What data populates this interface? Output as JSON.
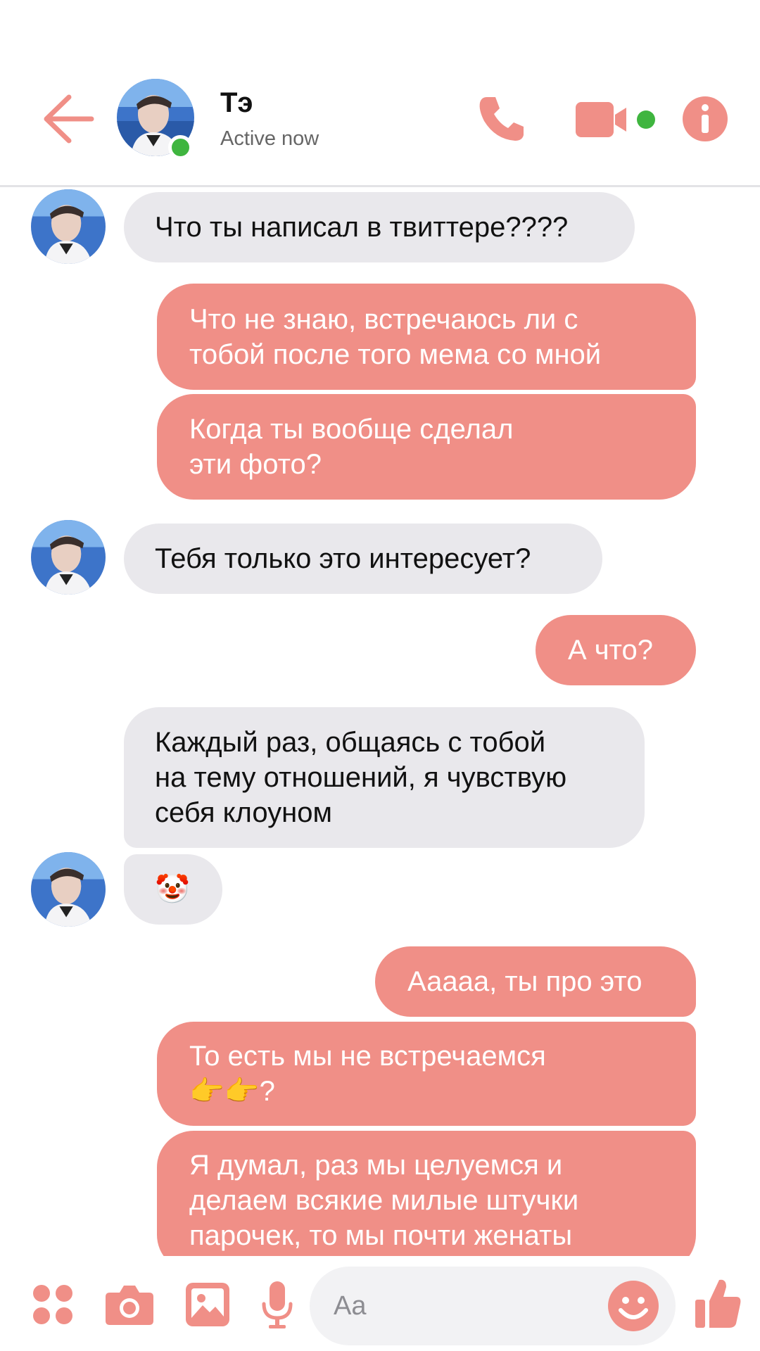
{
  "header": {
    "contact_name": "Тэ",
    "status": "Active now",
    "back_icon": "arrow-left-icon",
    "call_icon": "phone-icon",
    "video_icon": "video-camera-icon",
    "info_icon": "info-icon"
  },
  "colors": {
    "accent": "#f08f87",
    "incoming_bubble": "#e9e8ec",
    "online": "#3fb53f"
  },
  "messages": [
    {
      "direction": "incoming",
      "text": "Что ты написал в твиттере????"
    },
    {
      "direction": "outgoing",
      "text": "Что не знаю, встречаюсь ли с\nтобой после того мема со мной"
    },
    {
      "direction": "outgoing",
      "text": "Когда ты вообще сделал\nэти фото?"
    },
    {
      "direction": "incoming",
      "text": "Тебя только это интересует?"
    },
    {
      "direction": "outgoing",
      "text": "А что?"
    },
    {
      "direction": "incoming",
      "text": "Каждый раз, общаясь с тобой\nна тему отношений, я чувствую\nсебя клоуном"
    },
    {
      "direction": "incoming",
      "text": "🤡"
    },
    {
      "direction": "outgoing",
      "text": "Ааааа, ты про это"
    },
    {
      "direction": "outgoing",
      "text": "То есть мы не встречаемся\n👉👉?"
    },
    {
      "direction": "outgoing",
      "text": "Я думал, раз мы целуемся и\nделаем всякие милые штучки\nпарочек, то мы почти женаты"
    }
  ],
  "composer": {
    "placeholder": "Aa",
    "icons": [
      "apps-icon",
      "camera-icon",
      "gallery-icon",
      "microphone-icon",
      "emoji-icon",
      "thumbs-up-icon"
    ]
  }
}
